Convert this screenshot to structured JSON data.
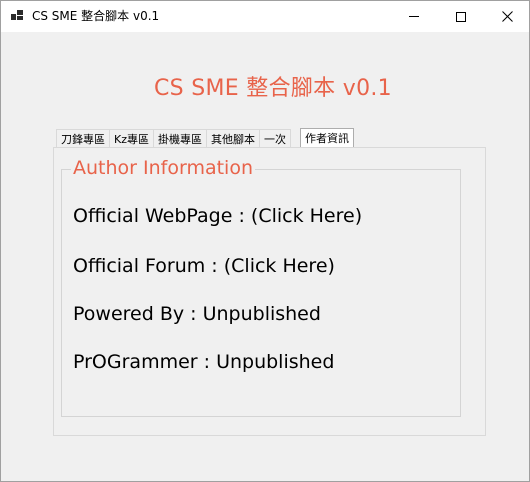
{
  "window": {
    "title": "CS SME 整合腳本 v0.1"
  },
  "header": {
    "title": "CS SME  整合腳本 v0.1"
  },
  "tabs": [
    {
      "label": "刀鋒專區"
    },
    {
      "label": "Kz專區"
    },
    {
      "label": "掛機專區"
    },
    {
      "label": "其他腳本"
    },
    {
      "label": "一次"
    },
    {
      "label": "作者資訊",
      "selected": true
    }
  ],
  "author": {
    "group_title": "Author Information",
    "webpage_label": "Official WebPage : ",
    "webpage_link": "(Click Here)",
    "forum_label": "Official Forum : ",
    "forum_link": "(Click Here)",
    "powered_by": "Powered By : Unpublished",
    "programmer": "PrOGrammer : Unpublished"
  },
  "colors": {
    "accent": "#e8634a"
  }
}
